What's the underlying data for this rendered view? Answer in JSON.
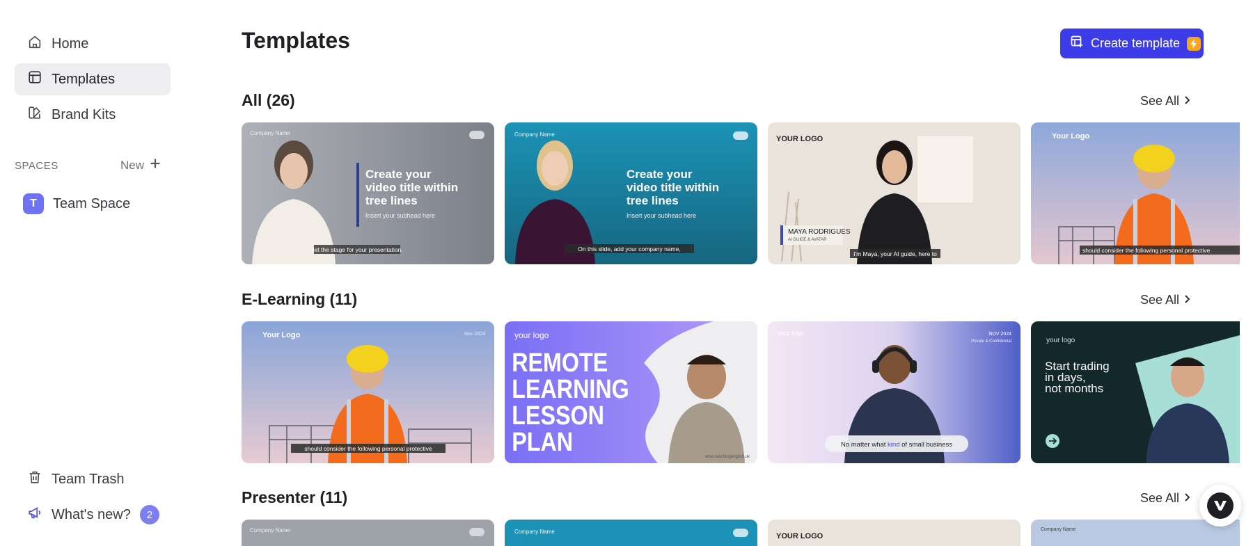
{
  "sidebar": {
    "nav": [
      {
        "label": "Home",
        "icon": "home-icon"
      },
      {
        "label": "Templates",
        "icon": "templates-icon"
      },
      {
        "label": "Brand Kits",
        "icon": "brand-kits-icon"
      }
    ],
    "spaces_label": "SPACES",
    "spaces_new_label": "New",
    "space": {
      "initial": "T",
      "label": "Team Space"
    },
    "trash_label": "Team Trash",
    "whats_new_label": "What's new?",
    "whats_new_count": "2"
  },
  "header": {
    "title": "Templates",
    "create_button_label": "Create template"
  },
  "sections": [
    {
      "title": "All (26)",
      "see_all": "See All",
      "cards": [
        {
          "corner": "Company Name",
          "headline": [
            "Create your",
            "video title within",
            "tree lines"
          ],
          "subhead": "Insert your subhead here",
          "caption": "set the stage for your presentation."
        },
        {
          "corner": "Company Name",
          "headline": [
            "Create your",
            "video title within",
            "tree lines"
          ],
          "subhead": "Insert your subhead here",
          "caption": "On this slide, add your company name,"
        },
        {
          "corner": "YOUR LOGO",
          "name": "MAYA RODRIGUES",
          "role": "AI GUIDE & AVATAR",
          "caption": "I'm Maya, your AI guide, here to"
        },
        {
          "corner": "Your Logo",
          "caption": "should consider the following personal protective"
        }
      ]
    },
    {
      "title": "E-Learning (11)",
      "see_all": "See All",
      "cards": [
        {
          "corner": "Your Logo",
          "date": "Nov 2024",
          "caption": "should consider the following personal protective"
        },
        {
          "corner": "your logo",
          "headline": [
            "REMOTE",
            "LEARNING",
            "LESSON",
            "PLAN"
          ],
          "footer": "www.teachingenglish.uk"
        },
        {
          "corner": "your logo",
          "date": "NOV 2024",
          "date_sub": "Private & Confidential",
          "caption_pre": "No matter what ",
          "caption_em": "kind",
          "caption_post": " of small business"
        },
        {
          "corner": "your logo",
          "headline": [
            "Start trading",
            "in days,",
            "not months"
          ]
        }
      ]
    },
    {
      "title": "Presenter (11)",
      "see_all": "See All",
      "cards": [
        {
          "corner": "Company Name"
        },
        {
          "corner": "Company Name"
        },
        {
          "corner": "YOUR LOGO"
        },
        {
          "corner": "Company Name"
        }
      ]
    }
  ],
  "colors": {
    "accent": "#3c3ce8",
    "bolt": "#f6a623",
    "badge": "#7d7ff0"
  }
}
